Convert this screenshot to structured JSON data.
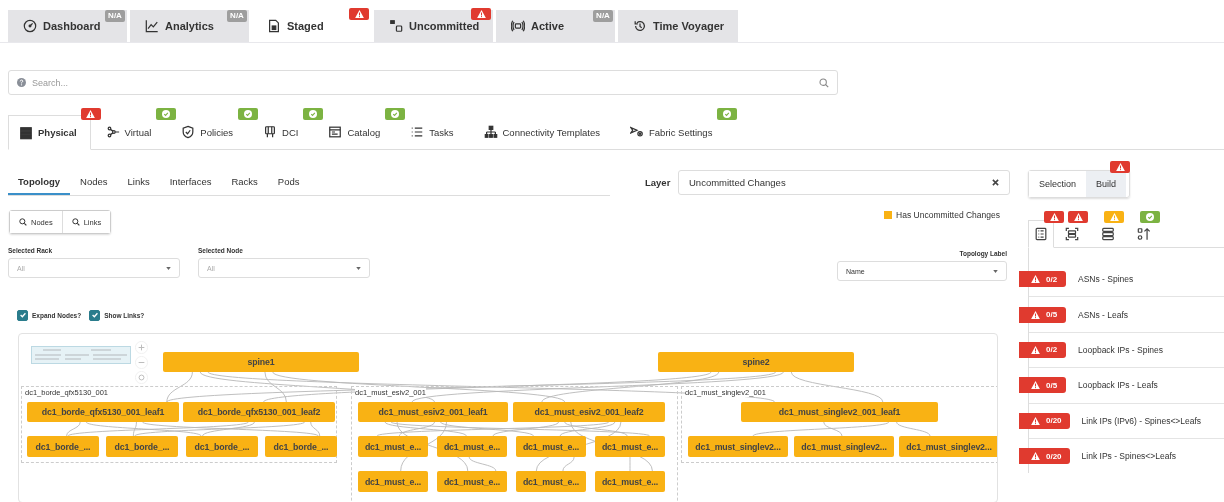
{
  "top_tabs": [
    {
      "label": "Dashboard",
      "selected": false,
      "badge": {
        "kind": "na",
        "text": "N/A"
      }
    },
    {
      "label": "Analytics",
      "selected": false,
      "badge": {
        "kind": "na",
        "text": "N/A"
      }
    },
    {
      "label": "Staged",
      "selected": true,
      "badge": {
        "kind": "error"
      }
    },
    {
      "label": "Uncommitted",
      "selected": false,
      "badge": {
        "kind": "error"
      }
    },
    {
      "label": "Active",
      "selected": false,
      "badge": {
        "kind": "na",
        "text": "N/A"
      }
    },
    {
      "label": "Time Voyager",
      "selected": false
    }
  ],
  "search": {
    "placeholder": "Search..."
  },
  "section_tabs": [
    {
      "label": "Physical",
      "selected": true,
      "badge": {
        "kind": "error"
      }
    },
    {
      "label": "Virtual",
      "selected": false,
      "badge": {
        "kind": "ok"
      }
    },
    {
      "label": "Policies",
      "selected": false,
      "badge": {
        "kind": "ok"
      }
    },
    {
      "label": "DCI",
      "selected": false,
      "badge": {
        "kind": "ok"
      }
    },
    {
      "label": "Catalog",
      "selected": false,
      "badge": {
        "kind": "ok"
      }
    },
    {
      "label": "Tasks",
      "selected": false
    },
    {
      "label": "Connectivity Templates",
      "selected": false
    },
    {
      "label": "Fabric Settings",
      "selected": false,
      "badge": {
        "kind": "ok"
      }
    }
  ],
  "view_tabs": [
    {
      "label": "Topology",
      "selected": true
    },
    {
      "label": "Nodes",
      "selected": false
    },
    {
      "label": "Links",
      "selected": false
    },
    {
      "label": "Interfaces",
      "selected": false
    },
    {
      "label": "Racks",
      "selected": false
    },
    {
      "label": "Pods",
      "selected": false
    }
  ],
  "layer": {
    "label": "Layer",
    "value": "Uncommitted Changes"
  },
  "search_buttons": [
    "Nodes",
    "Links"
  ],
  "legend": {
    "label": "Has Uncommitted Changes",
    "color": "#f9b214"
  },
  "filters": [
    {
      "label": "Selected Rack",
      "placeholder": "All"
    },
    {
      "label": "Selected Node",
      "placeholder": "All"
    }
  ],
  "topology_label": {
    "label": "Topology Label",
    "value": "Name"
  },
  "options": [
    {
      "label": "Expand Nodes?",
      "checked": true
    },
    {
      "label": "Show Links?",
      "checked": true
    }
  ],
  "topology": {
    "groups": [
      {
        "label": "dc1_borde_qfx5130_001"
      },
      {
        "label": "dc1_must_esiv2_001"
      },
      {
        "label": "dc1_must_singlev2_001"
      }
    ],
    "nodes": [
      {
        "label": "spine1",
        "uncommitted": true
      },
      {
        "label": "spine2",
        "uncommitted": true
      },
      {
        "label": "dc1_borde_qfx5130_001_leaf1",
        "uncommitted": true
      },
      {
        "label": "dc1_borde_qfx5130_001_leaf2",
        "uncommitted": true
      },
      {
        "label": "dc1_must_esiv2_001_leaf1",
        "uncommitted": true
      },
      {
        "label": "dc1_must_esiv2_001_leaf2",
        "uncommitted": true
      },
      {
        "label": "dc1_must_singlev2_001_leaf1",
        "uncommitted": true
      },
      {
        "label": "dc1_borde_...",
        "uncommitted": true
      },
      {
        "label": "dc1_borde_...",
        "uncommitted": true
      },
      {
        "label": "dc1_borde_...",
        "uncommitted": true
      },
      {
        "label": "dc1_borde_...",
        "uncommitted": true
      },
      {
        "label": "dc1_must_e...",
        "uncommitted": true
      },
      {
        "label": "dc1_must_e...",
        "uncommitted": true
      },
      {
        "label": "dc1_must_e...",
        "uncommitted": true
      },
      {
        "label": "dc1_must_e...",
        "uncommitted": true
      },
      {
        "label": "dc1_must_singlev2...",
        "uncommitted": true
      },
      {
        "label": "dc1_must_singlev2...",
        "uncommitted": true
      },
      {
        "label": "dc1_must_singlev2...",
        "uncommitted": true
      },
      {
        "label": "dc1_must_e...",
        "uncommitted": true
      },
      {
        "label": "dc1_must_e...",
        "uncommitted": true
      },
      {
        "label": "dc1_must_e...",
        "uncommitted": true
      },
      {
        "label": "dc1_must_e...",
        "uncommitted": true
      }
    ]
  },
  "mode_toggle": [
    {
      "label": "Selection",
      "selected": false
    },
    {
      "label": "Build",
      "selected": true,
      "badge": {
        "kind": "error"
      }
    }
  ],
  "build_tabs": [
    {
      "selected": true,
      "badge": {
        "kind": "error"
      }
    },
    {
      "selected": false,
      "badge": {
        "kind": "error"
      }
    },
    {
      "selected": false,
      "badge": {
        "kind": "warning"
      }
    },
    {
      "selected": false,
      "badge": {
        "kind": "ok"
      }
    }
  ],
  "build_items": [
    {
      "count": "0/2",
      "label": "ASNs - Spines",
      "kind": "error"
    },
    {
      "count": "0/5",
      "label": "ASNs - Leafs",
      "kind": "error"
    },
    {
      "count": "0/2",
      "label": "Loopback IPs - Spines",
      "kind": "error"
    },
    {
      "count": "0/5",
      "label": "Loopback IPs - Leafs",
      "kind": "error"
    },
    {
      "count": "0/20",
      "label": "Link IPs (IPv6) - Spines<>Leafs",
      "kind": "error"
    },
    {
      "count": "0/20",
      "label": "Link IPs - Spines<>Leafs",
      "kind": "error"
    }
  ]
}
